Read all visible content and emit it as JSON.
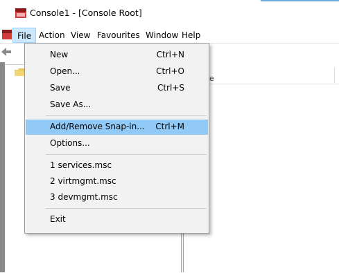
{
  "window": {
    "title": "Console1 - [Console Root]"
  },
  "menubar": {
    "items": [
      {
        "label": "File",
        "active": true
      },
      {
        "label": "Action"
      },
      {
        "label": "View"
      },
      {
        "label": "Favourites"
      },
      {
        "label": "Window"
      },
      {
        "label": "Help"
      }
    ]
  },
  "right_pane": {
    "header_fragment": "e"
  },
  "file_menu": {
    "items": [
      {
        "label": "New",
        "shortcut": "Ctrl+N"
      },
      {
        "label": "Open...",
        "shortcut": "Ctrl+O"
      },
      {
        "label": "Save",
        "shortcut": "Ctrl+S"
      },
      {
        "label": "Save As...",
        "shortcut": ""
      },
      {
        "label": "Add/Remove Snap-in...",
        "shortcut": "Ctrl+M",
        "highlighted": true
      },
      {
        "label": "Options...",
        "shortcut": ""
      },
      {
        "label": "1 services.msc",
        "shortcut": ""
      },
      {
        "label": "2 virtmgmt.msc",
        "shortcut": ""
      },
      {
        "label": "3 devmgmt.msc",
        "shortcut": ""
      },
      {
        "label": "Exit",
        "shortcut": ""
      }
    ]
  },
  "colors": {
    "menu_background": "#f2f2f2",
    "highlight": "#91c9f7",
    "menubar_active": "#cce8ff",
    "accent_line": "#6fa8dc"
  },
  "icons": [
    "console-app-icon",
    "mmc-menu-icon",
    "back-arrow-icon",
    "folder-icon"
  ]
}
